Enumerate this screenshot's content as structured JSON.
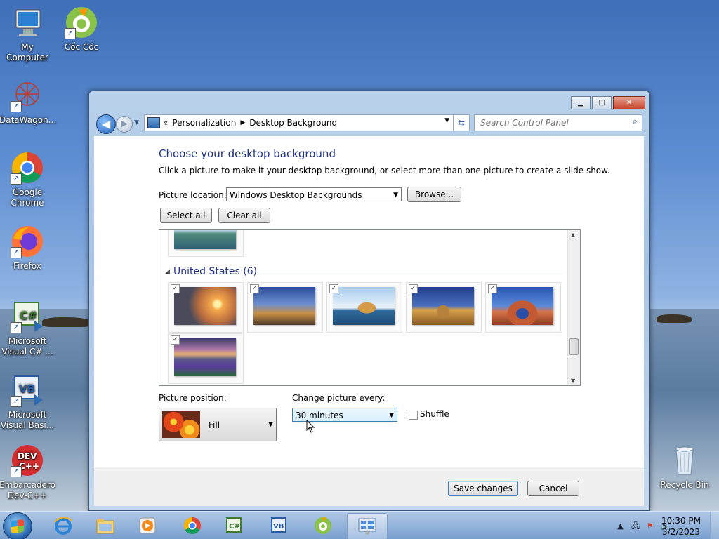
{
  "desktop": {
    "icons": [
      {
        "label": "My Computer"
      },
      {
        "label": "Cốc Cốc"
      },
      {
        "label": "DataWagon..."
      },
      {
        "label": "Google Chrome"
      },
      {
        "label": "Firefox"
      },
      {
        "label": "Microsoft Visual C# ..."
      },
      {
        "label": "Microsoft Visual Basi..."
      },
      {
        "label": "Embarcadero Dev-C++"
      },
      {
        "label": "Recycle Bin"
      }
    ]
  },
  "window": {
    "controls": {
      "minimize": "▁",
      "maximize": "□",
      "close": "✕"
    },
    "nav": {
      "back": "◀",
      "forward": "▶"
    },
    "breadcrumb": {
      "prefix": "«",
      "items": [
        "Personalization",
        "Desktop Background"
      ]
    },
    "search": {
      "placeholder": "Search Control Panel"
    },
    "title": "Choose your desktop background",
    "description": "Click a picture to make it your desktop background, or select more than one picture to create a slide show.",
    "picture_location": {
      "label": "Picture location:",
      "value": "Windows Desktop Backgrounds",
      "browse": "Browse..."
    },
    "select_all": "Select all",
    "clear_all": "Clear all",
    "group": {
      "name": "United States (6)",
      "items": 6
    },
    "picture_position": {
      "label": "Picture position:",
      "value": "Fill"
    },
    "change_every": {
      "label": "Change picture every:",
      "value": "30 minutes"
    },
    "shuffle": {
      "label": "Shuffle",
      "checked": false
    },
    "save": "Save changes",
    "cancel": "Cancel"
  },
  "taskbar": {
    "apps": [
      "Internet Explorer",
      "Windows Explorer",
      "Windows Media Player",
      "Google Chrome",
      "Visual C#",
      "Visual Basic",
      "Cốc Cốc",
      "Control Panel"
    ],
    "clock": {
      "time": "10:30 PM",
      "date": "3/2/2023"
    }
  }
}
